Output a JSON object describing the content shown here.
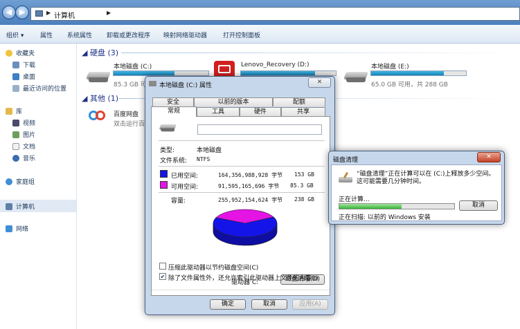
{
  "window": {
    "address": [
      "计算机"
    ],
    "back_icon": "back-arrow-icon",
    "forward_icon": "forward-arrow-icon"
  },
  "toolbar": {
    "organize": "组织 ▾",
    "properties": "属性",
    "system_properties": "系统属性",
    "uninstall": "卸载或更改程序",
    "map_drive": "映射网络驱动器",
    "control_panel": "打开控制面板"
  },
  "sidebar": {
    "favorites": "收藏夹",
    "downloads": "下载",
    "desktop": "桌面",
    "recent": "最近访问的位置",
    "libraries": "库",
    "videos": "视频",
    "pictures": "图片",
    "documents": "文档",
    "music": "音乐",
    "homegroup": "家庭组",
    "computer": "计算机",
    "network": "网络"
  },
  "content": {
    "hdd_section": "硬盘 (3)",
    "other_section": "其他 (1)",
    "drives": [
      {
        "name": "本地磁盘 (C:)",
        "free_text": "85.3 GB 可用",
        "used_fraction": 0.64
      },
      {
        "name": "Lenovo_Recovery (D:)",
        "free_text": "",
        "used_fraction": 0.78
      },
      {
        "name": "本地磁盘 (E:)",
        "free_text": "65.0 GB 可用，共 288 GB",
        "used_fraction": 0.77
      }
    ],
    "other_item": {
      "name": "百度网盘",
      "desc": "双击运行百"
    }
  },
  "properties_dialog": {
    "title": "本地磁盘 (C:) 属性",
    "close": "✕",
    "tabs_back": [
      "安全",
      "以前的版本",
      "配额"
    ],
    "tabs_front": [
      "常规",
      "工具",
      "硬件",
      "共享"
    ],
    "type_label": "类型:",
    "type_value": "本地磁盘",
    "fs_label": "文件系统:",
    "fs_value": "NTFS",
    "used_label": "已用空间:",
    "used_bytes": "164,356,988,928 字节",
    "used_size": "153 GB",
    "free_label": "可用空间:",
    "free_bytes": "91,595,165,696 字节",
    "free_size": "85.3 GB",
    "capacity_label": "容量:",
    "capacity_bytes": "255,952,154,624 字节",
    "capacity_size": "238 GB",
    "drive_label": "驱动器 C:",
    "cleanup_button": "磁盘清理(D)",
    "compress_label": "压缩此驱动器以节约磁盘空间(C)",
    "compress_checked": false,
    "index_label": "除了文件属性外，还允许索引此驱动器上文件的内容(I)",
    "index_checked": true,
    "ok": "确定",
    "cancel": "取消",
    "apply": "应用(A)",
    "used_color": "#1414e8",
    "free_color": "#e414e4",
    "used_fraction": 0.642
  },
  "cleanup_dialog": {
    "title": "磁盘清理",
    "close": "✕",
    "message": "“磁盘清理”正在计算可以在 (C:)上释放多少空间。这可能需要几分钟时间。",
    "calculating": "正在计算...",
    "cancel": "取消",
    "scanning": "正在扫描:  以前的 Windows 安装",
    "progress_fraction": 0.54
  }
}
